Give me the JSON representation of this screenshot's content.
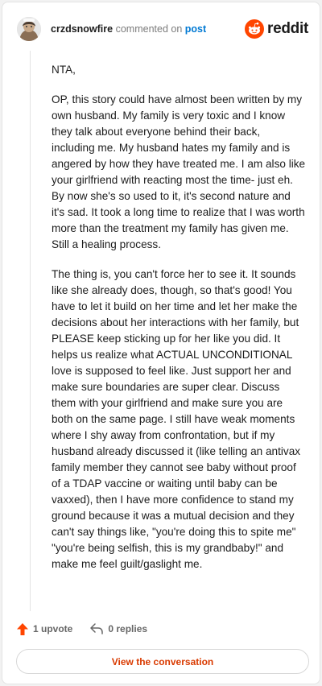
{
  "header": {
    "username": "crzdsnowfire",
    "action_text": "commented on",
    "post_link": "post",
    "brand": "reddit"
  },
  "comment": {
    "paragraphs": [
      "NTA,",
      "OP, this story could have almost been written by my own husband. My family is very toxic and I know they talk about everyone behind their back, including me. My husband hates my family and is angered by how they have treated me. I am also like your girlfriend with reacting most the time- just eh. By now she's so used to it, it's second nature and it's sad. It took a long time to realize that I was worth more than the treatment my family has given me. Still a healing process.",
      "The thing is, you can't force her to see it. It sounds like she already does, though, so that's good! You have to let it build on her time and let her make the decisions about her interactions with her family, but PLEASE keep sticking up for her like you did. It helps us realize what ACTUAL UNCONDITIONAL love is supposed to feel like. Just support her and make sure boundaries are super clear. Discuss them with your girlfriend and make sure you are both on the same page. I still have weak moments where I shy away from confrontation, but if my husband already discussed it (like telling an antivax family member they cannot see baby without proof of a TDAP vaccine or waiting until baby can be vaxxed), then I have more confidence to stand my ground because it was a mutual decision and they can't say things like, \"you're doing this to spite me\" \"you're being selfish, this is my grandbaby!\" and make me feel guilt/gaslight me."
    ]
  },
  "footer": {
    "upvotes": "1 upvote",
    "replies": "0 replies",
    "cta": "View the conversation"
  },
  "colors": {
    "brand_orange": "#ff4500",
    "link_blue": "#0079d3",
    "cta_text": "#d93a00"
  },
  "icons": [
    "avatar",
    "reddit-logo-icon",
    "upvote-arrow-icon",
    "reply-icon"
  ]
}
